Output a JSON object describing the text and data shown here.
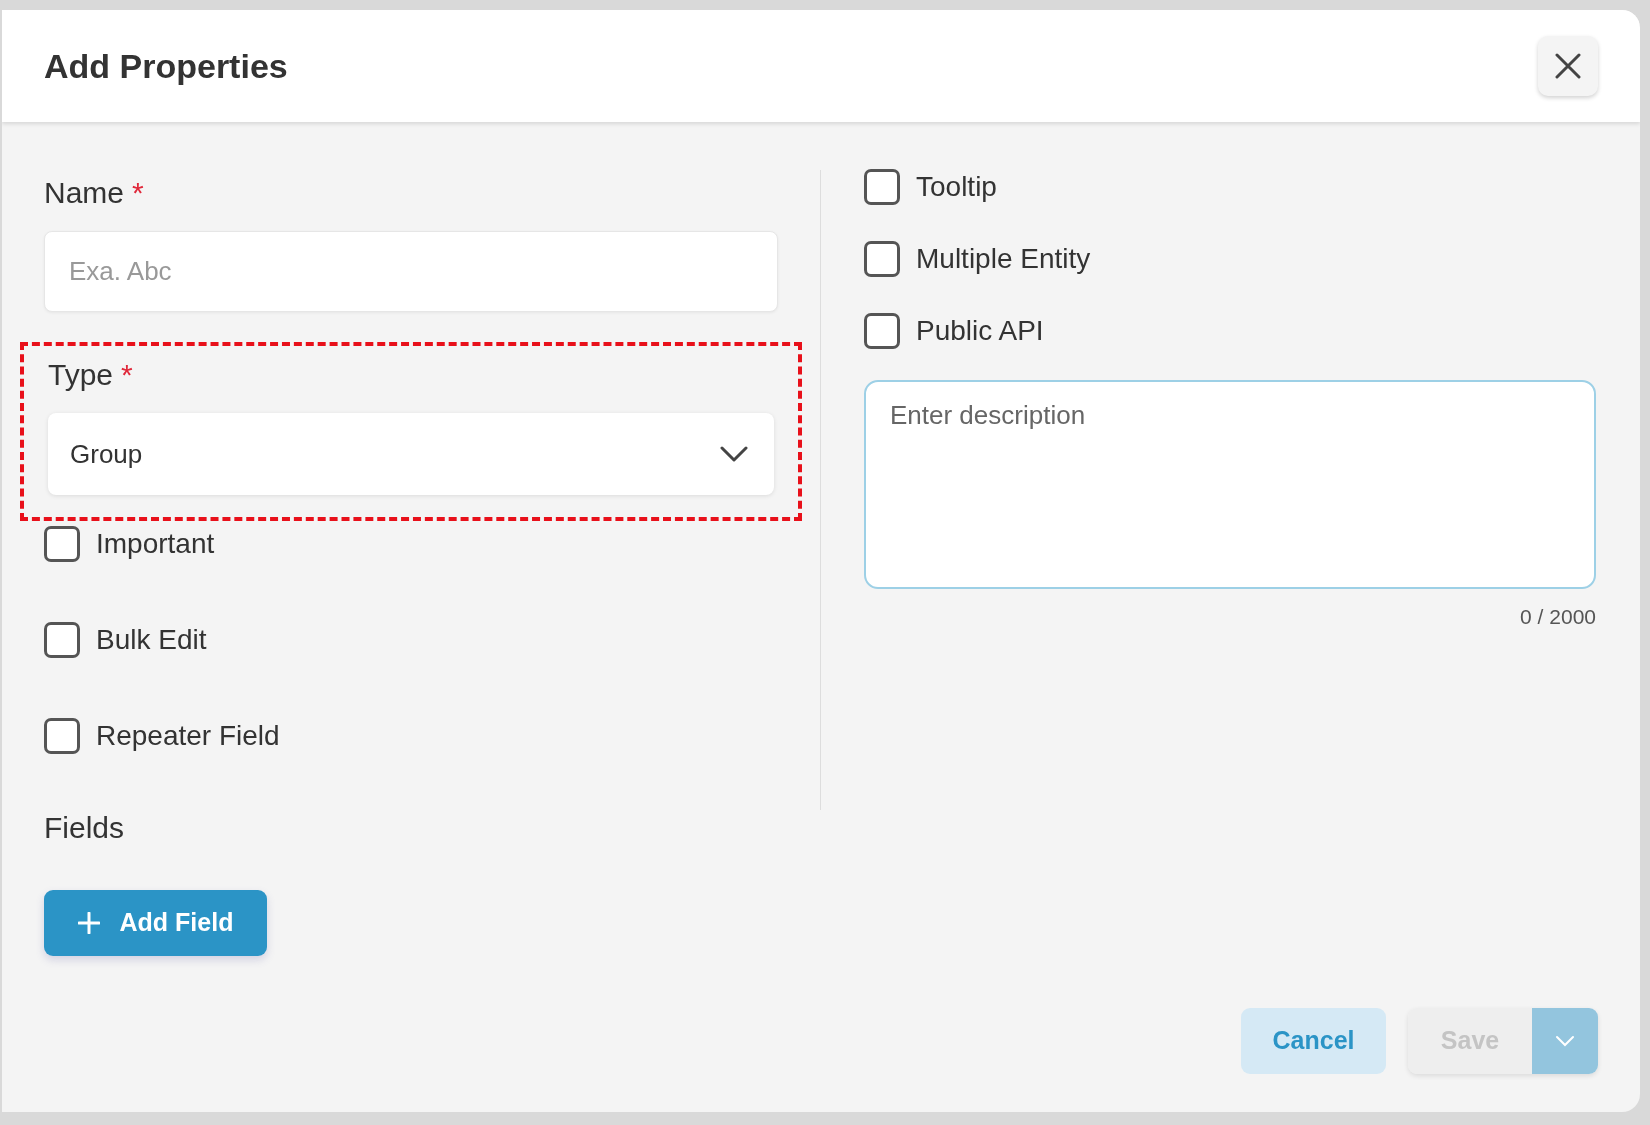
{
  "dialog": {
    "title": "Add Properties"
  },
  "name_field": {
    "label": "Name",
    "required_mark": "*",
    "placeholder": "Exa. Abc"
  },
  "type_field": {
    "label": "Type",
    "required_mark": "*",
    "value": "Group",
    "highlighted": true
  },
  "left_options": [
    {
      "label": "Important",
      "checked": false
    },
    {
      "label": "Bulk Edit",
      "checked": false
    },
    {
      "label": "Repeater Field",
      "checked": false
    }
  ],
  "fields_section": {
    "title": "Fields",
    "add_button": "Add Field"
  },
  "right_options": [
    {
      "label": "Tooltip",
      "checked": false
    },
    {
      "label": "Multiple Entity",
      "checked": false
    },
    {
      "label": "Public API",
      "checked": false
    }
  ],
  "description": {
    "placeholder": "Enter description",
    "counter": "0 / 2000"
  },
  "footer": {
    "cancel": "Cancel",
    "save": "Save",
    "save_disabled": true
  }
}
